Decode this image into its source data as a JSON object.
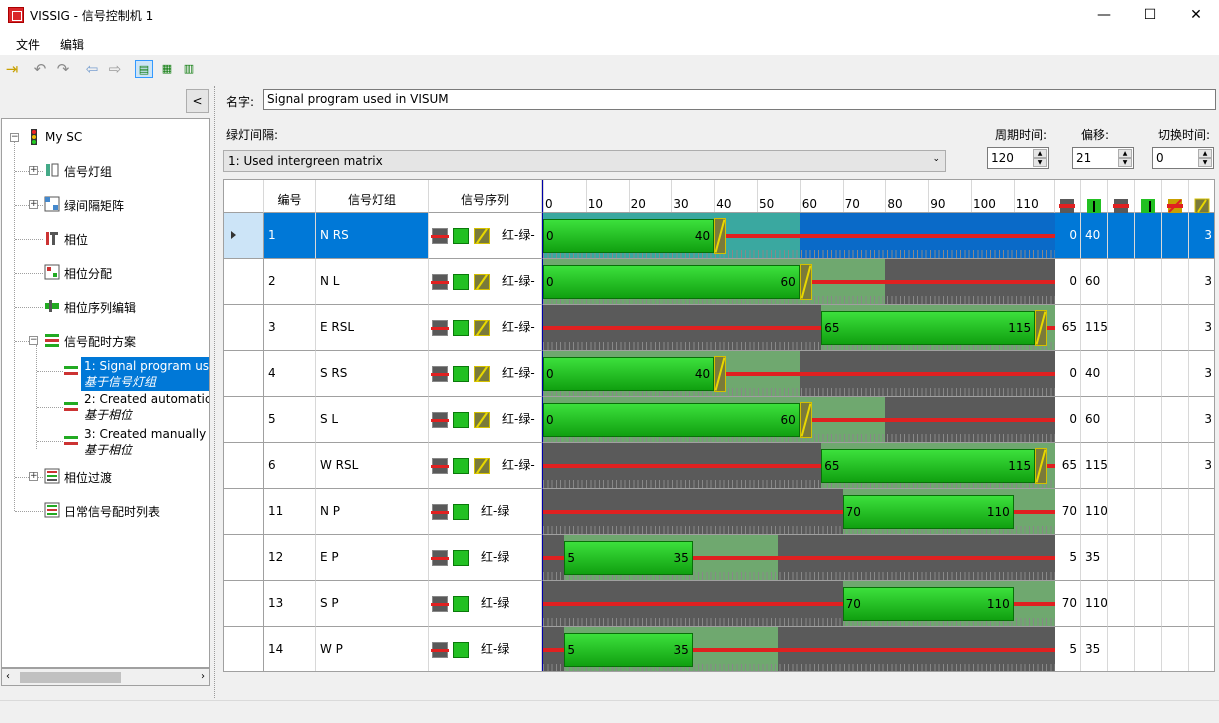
{
  "window": {
    "title": "VISSIG - 信号控制机 1",
    "minimize": "—",
    "maximize": "☐",
    "close": "✕"
  },
  "menu": {
    "file": "文件",
    "edit": "编辑"
  },
  "toolbar": {
    "icons": [
      "exit-icon",
      "undo-icon",
      "redo-icon",
      "back-icon",
      "forward-icon",
      "signal-view-icon",
      "stage-view-icon",
      "table-view-icon"
    ]
  },
  "tree": {
    "collapse": "<",
    "root": "My SC",
    "items": [
      "信号灯组",
      "绿间隔矩阵",
      "相位",
      "相位分配",
      "相位序列编辑",
      "信号配时方案"
    ],
    "programs": [
      {
        "label": "1: Signal program us",
        "sub": "基于信号灯组"
      },
      {
        "label": "2: Created automatic",
        "sub": "基于相位"
      },
      {
        "label": "3: Created manually",
        "sub": "基于相位"
      }
    ],
    "after": [
      "相位过渡",
      "日常信号配时列表"
    ]
  },
  "form": {
    "name_label": "名字:",
    "name_value": "Signal program used in VISUM",
    "intergreen_label": "绿灯间隔:",
    "intergreen_value": "1: Used intergreen matrix",
    "cycle_label": "周期时间:",
    "cycle_value": "120",
    "offset_label": "偏移:",
    "offset_value": "21",
    "switch_label": "切换时间:",
    "switch_value": "0"
  },
  "grid": {
    "headers": {
      "no": "编号",
      "group": "信号灯组",
      "seq": "信号序列"
    },
    "axis_ticks": [
      "0",
      "10",
      "20",
      "30",
      "40",
      "50",
      "60",
      "70",
      "80",
      "90",
      "100",
      "110"
    ],
    "cycle": 120,
    "rows": [
      {
        "no": "1",
        "name": "N RS",
        "seq": "红-绿-",
        "amber": true,
        "start": 0,
        "end": 40,
        "last": "3"
      },
      {
        "no": "2",
        "name": "N L",
        "seq": "红-绿-",
        "amber": true,
        "start": 0,
        "end": 60,
        "last": "3"
      },
      {
        "no": "3",
        "name": "E RSL",
        "seq": "红-绿-",
        "amber": true,
        "start": 65,
        "end": 115,
        "last": "3"
      },
      {
        "no": "4",
        "name": "S RS",
        "seq": "红-绿-",
        "amber": true,
        "start": 0,
        "end": 40,
        "last": "3"
      },
      {
        "no": "5",
        "name": "S L",
        "seq": "红-绿-",
        "amber": true,
        "start": 0,
        "end": 60,
        "last": "3"
      },
      {
        "no": "6",
        "name": "W RSL",
        "seq": "红-绿-",
        "amber": true,
        "start": 65,
        "end": 115,
        "last": "3"
      },
      {
        "no": "11",
        "name": "N P",
        "seq": "红-绿",
        "amber": false,
        "start": 70,
        "end": 110,
        "last": ""
      },
      {
        "no": "12",
        "name": "E P",
        "seq": "红-绿",
        "amber": false,
        "start": 5,
        "end": 35,
        "last": ""
      },
      {
        "no": "13",
        "name": "S P",
        "seq": "红-绿",
        "amber": false,
        "start": 70,
        "end": 110,
        "last": ""
      },
      {
        "no": "14",
        "name": "W P",
        "seq": "红-绿",
        "amber": false,
        "start": 5,
        "end": 35,
        "last": ""
      }
    ]
  }
}
